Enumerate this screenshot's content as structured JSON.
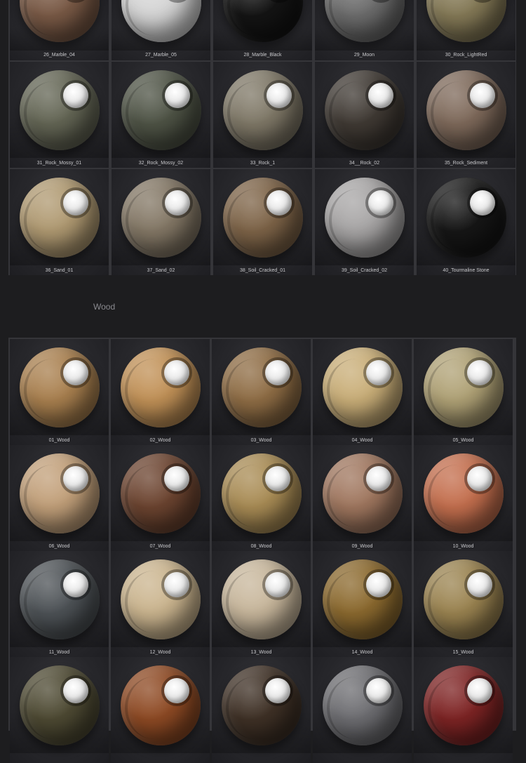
{
  "stone_section": {
    "items": [
      {
        "label": "26_Marble_04",
        "color": "#7a5a46"
      },
      {
        "label": "27_Marble_05",
        "color": "#d6d6d6"
      },
      {
        "label": "28_Marble_Black",
        "color": "#141414"
      },
      {
        "label": "29_Moon",
        "color": "#6d6d6d"
      },
      {
        "label": "30_Rock_LightRed",
        "color": "#857a57"
      },
      {
        "label": "31_Rock_Mossy_01",
        "color": "#646655"
      },
      {
        "label": "32_Rock_Mossy_02",
        "color": "#4f5446"
      },
      {
        "label": "33_Rock_1",
        "color": "#807968"
      },
      {
        "label": "34__Rock_02",
        "color": "#403a34"
      },
      {
        "label": "35_Rock_Sediment",
        "color": "#7f6a5b"
      },
      {
        "label": "36_Sand_01",
        "color": "#b09a72"
      },
      {
        "label": "37_Sand_02",
        "color": "#847866"
      },
      {
        "label": "38_Soil_Cracked_01",
        "color": "#7e6448"
      },
      {
        "label": "39_Soil_Cracked_02",
        "color": "#a8a6a6"
      },
      {
        "label": "40_Tourmaline Stone",
        "color": "#161616"
      }
    ]
  },
  "wood_section": {
    "title": "Wood",
    "items": [
      {
        "label": "01_Wood",
        "color": "#a9804f"
      },
      {
        "label": "02_Wood",
        "color": "#c19157"
      },
      {
        "label": "03_Wood",
        "color": "#8f6d45"
      },
      {
        "label": "04_Wood",
        "color": "#c9ae78"
      },
      {
        "label": "05_Wood",
        "color": "#b0a276"
      },
      {
        "label": "06_Wood",
        "color": "#c2a07a"
      },
      {
        "label": "07_Wood",
        "color": "#6c4430"
      },
      {
        "label": "08_Wood",
        "color": "#a98c55"
      },
      {
        "label": "09_Wood",
        "color": "#a0775f"
      },
      {
        "label": "10_Wood",
        "color": "#c46f4e"
      },
      {
        "label": "11_Wood",
        "color": "#4e5357"
      },
      {
        "label": "12_Wood",
        "color": "#cbb58f"
      },
      {
        "label": "13_Wood",
        "color": "#c8b79c"
      },
      {
        "label": "14_Wood",
        "color": "#8c6a2f"
      },
      {
        "label": "15_Wood",
        "color": "#9b8451"
      },
      {
        "label": "",
        "color": "#4e4a33"
      },
      {
        "label": "",
        "color": "#8e4a24"
      },
      {
        "label": "",
        "color": "#3f3126"
      },
      {
        "label": "",
        "color": "#6e6e72"
      },
      {
        "label": "",
        "color": "#7e2424"
      }
    ]
  }
}
